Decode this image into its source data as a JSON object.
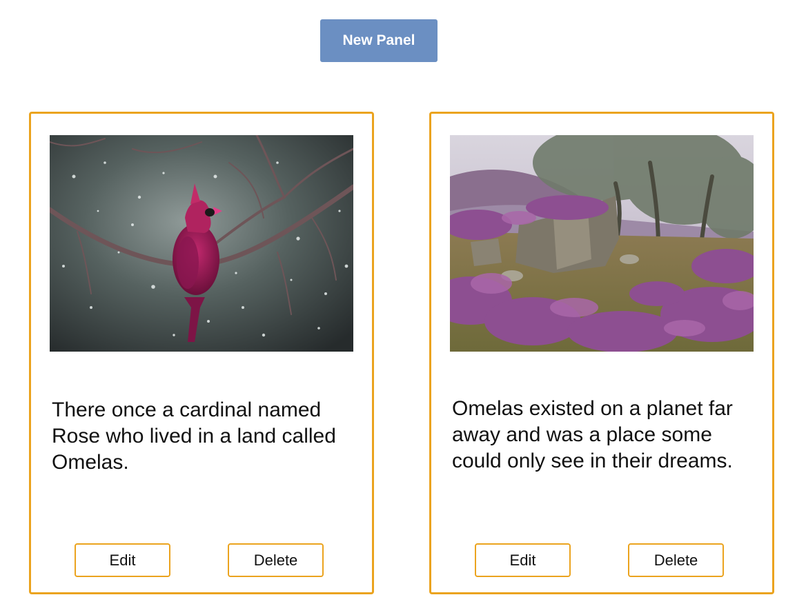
{
  "header": {
    "new_panel_label": "New Panel"
  },
  "panels": [
    {
      "image_subject": "red cardinal on a snowy branch",
      "text": "There once a cardinal named Rose who lived in a land called Omelas.",
      "edit_label": "Edit",
      "delete_label": "Delete"
    },
    {
      "image_subject": "misty moorland with heather, rocks and trees",
      "text": "Omelas existed on a planet far away and was a place some could only see in their dreams.",
      "edit_label": "Edit",
      "delete_label": "Delete"
    }
  ],
  "colors": {
    "accent_border": "#eba31e",
    "primary_button": "#6b8fc2"
  }
}
